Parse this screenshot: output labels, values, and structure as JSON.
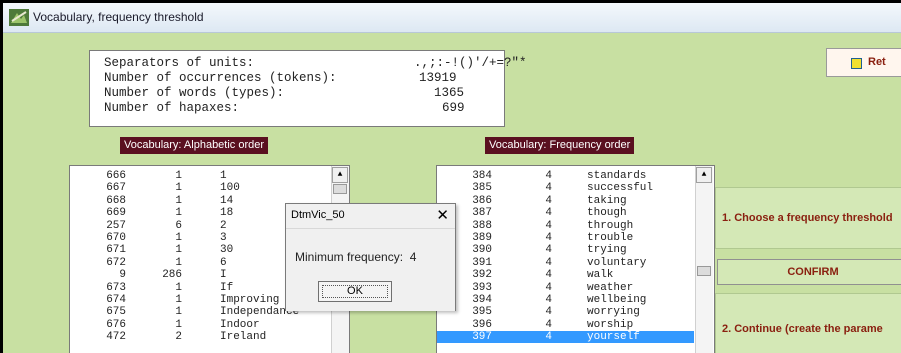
{
  "window": {
    "title": "Vocabulary, frequency threshold",
    "icon": "app-icon"
  },
  "stats": {
    "rows": [
      {
        "label": "Separators of units:",
        "value": ".,;:-!()'/+=?\"*"
      },
      {
        "label": "Number of occurrences (tokens):",
        "value": "13919"
      },
      {
        "label": "Number of words (types):",
        "value": "1365"
      },
      {
        "label": "Number of hapaxes:",
        "value": "699"
      }
    ]
  },
  "alpha": {
    "header": "Vocabulary: Alphabetic order",
    "rows": [
      [
        "666",
        "1",
        "1"
      ],
      [
        "667",
        "1",
        "100"
      ],
      [
        "668",
        "1",
        "14"
      ],
      [
        "669",
        "1",
        "18"
      ],
      [
        "257",
        "6",
        "2"
      ],
      [
        "670",
        "1",
        "3"
      ],
      [
        "671",
        "1",
        "30"
      ],
      [
        "672",
        "1",
        "6"
      ],
      [
        "9",
        "286",
        "I"
      ],
      [
        "673",
        "1",
        "If"
      ],
      [
        "674",
        "1",
        "Improving"
      ],
      [
        "675",
        "1",
        "Independance"
      ],
      [
        "676",
        "1",
        "Indoor"
      ],
      [
        "472",
        "2",
        "Ireland"
      ]
    ]
  },
  "freq": {
    "header": "Vocabulary: Frequency order",
    "rows": [
      [
        "384",
        "4",
        "standards"
      ],
      [
        "385",
        "4",
        "successful"
      ],
      [
        "386",
        "4",
        "taking"
      ],
      [
        "387",
        "4",
        "though"
      ],
      [
        "388",
        "4",
        "through"
      ],
      [
        "389",
        "4",
        "trouble"
      ],
      [
        "390",
        "4",
        "trying"
      ],
      [
        "391",
        "4",
        "voluntary"
      ],
      [
        "392",
        "4",
        "walk"
      ],
      [
        "393",
        "4",
        "weather"
      ],
      [
        "394",
        "4",
        "wellbeing"
      ],
      [
        "395",
        "4",
        "worrying"
      ],
      [
        "396",
        "4",
        "worship"
      ],
      [
        "397",
        "4",
        "yourself"
      ]
    ],
    "selected_index": 13
  },
  "buttons": {
    "return": "Ret",
    "confirm": "CONFIRM"
  },
  "steps": {
    "step1": "1. Choose a frequency threshold",
    "step2": "2. Continue   (create the parame"
  },
  "dialog": {
    "title": "DtmVic_50",
    "message": "Minimum frequency:  4",
    "ok": "OK"
  },
  "colors": {
    "background": "#c8e0a2",
    "header_bg": "#5a1020",
    "accent_text": "#8a2010",
    "selection": "#3399ff"
  }
}
